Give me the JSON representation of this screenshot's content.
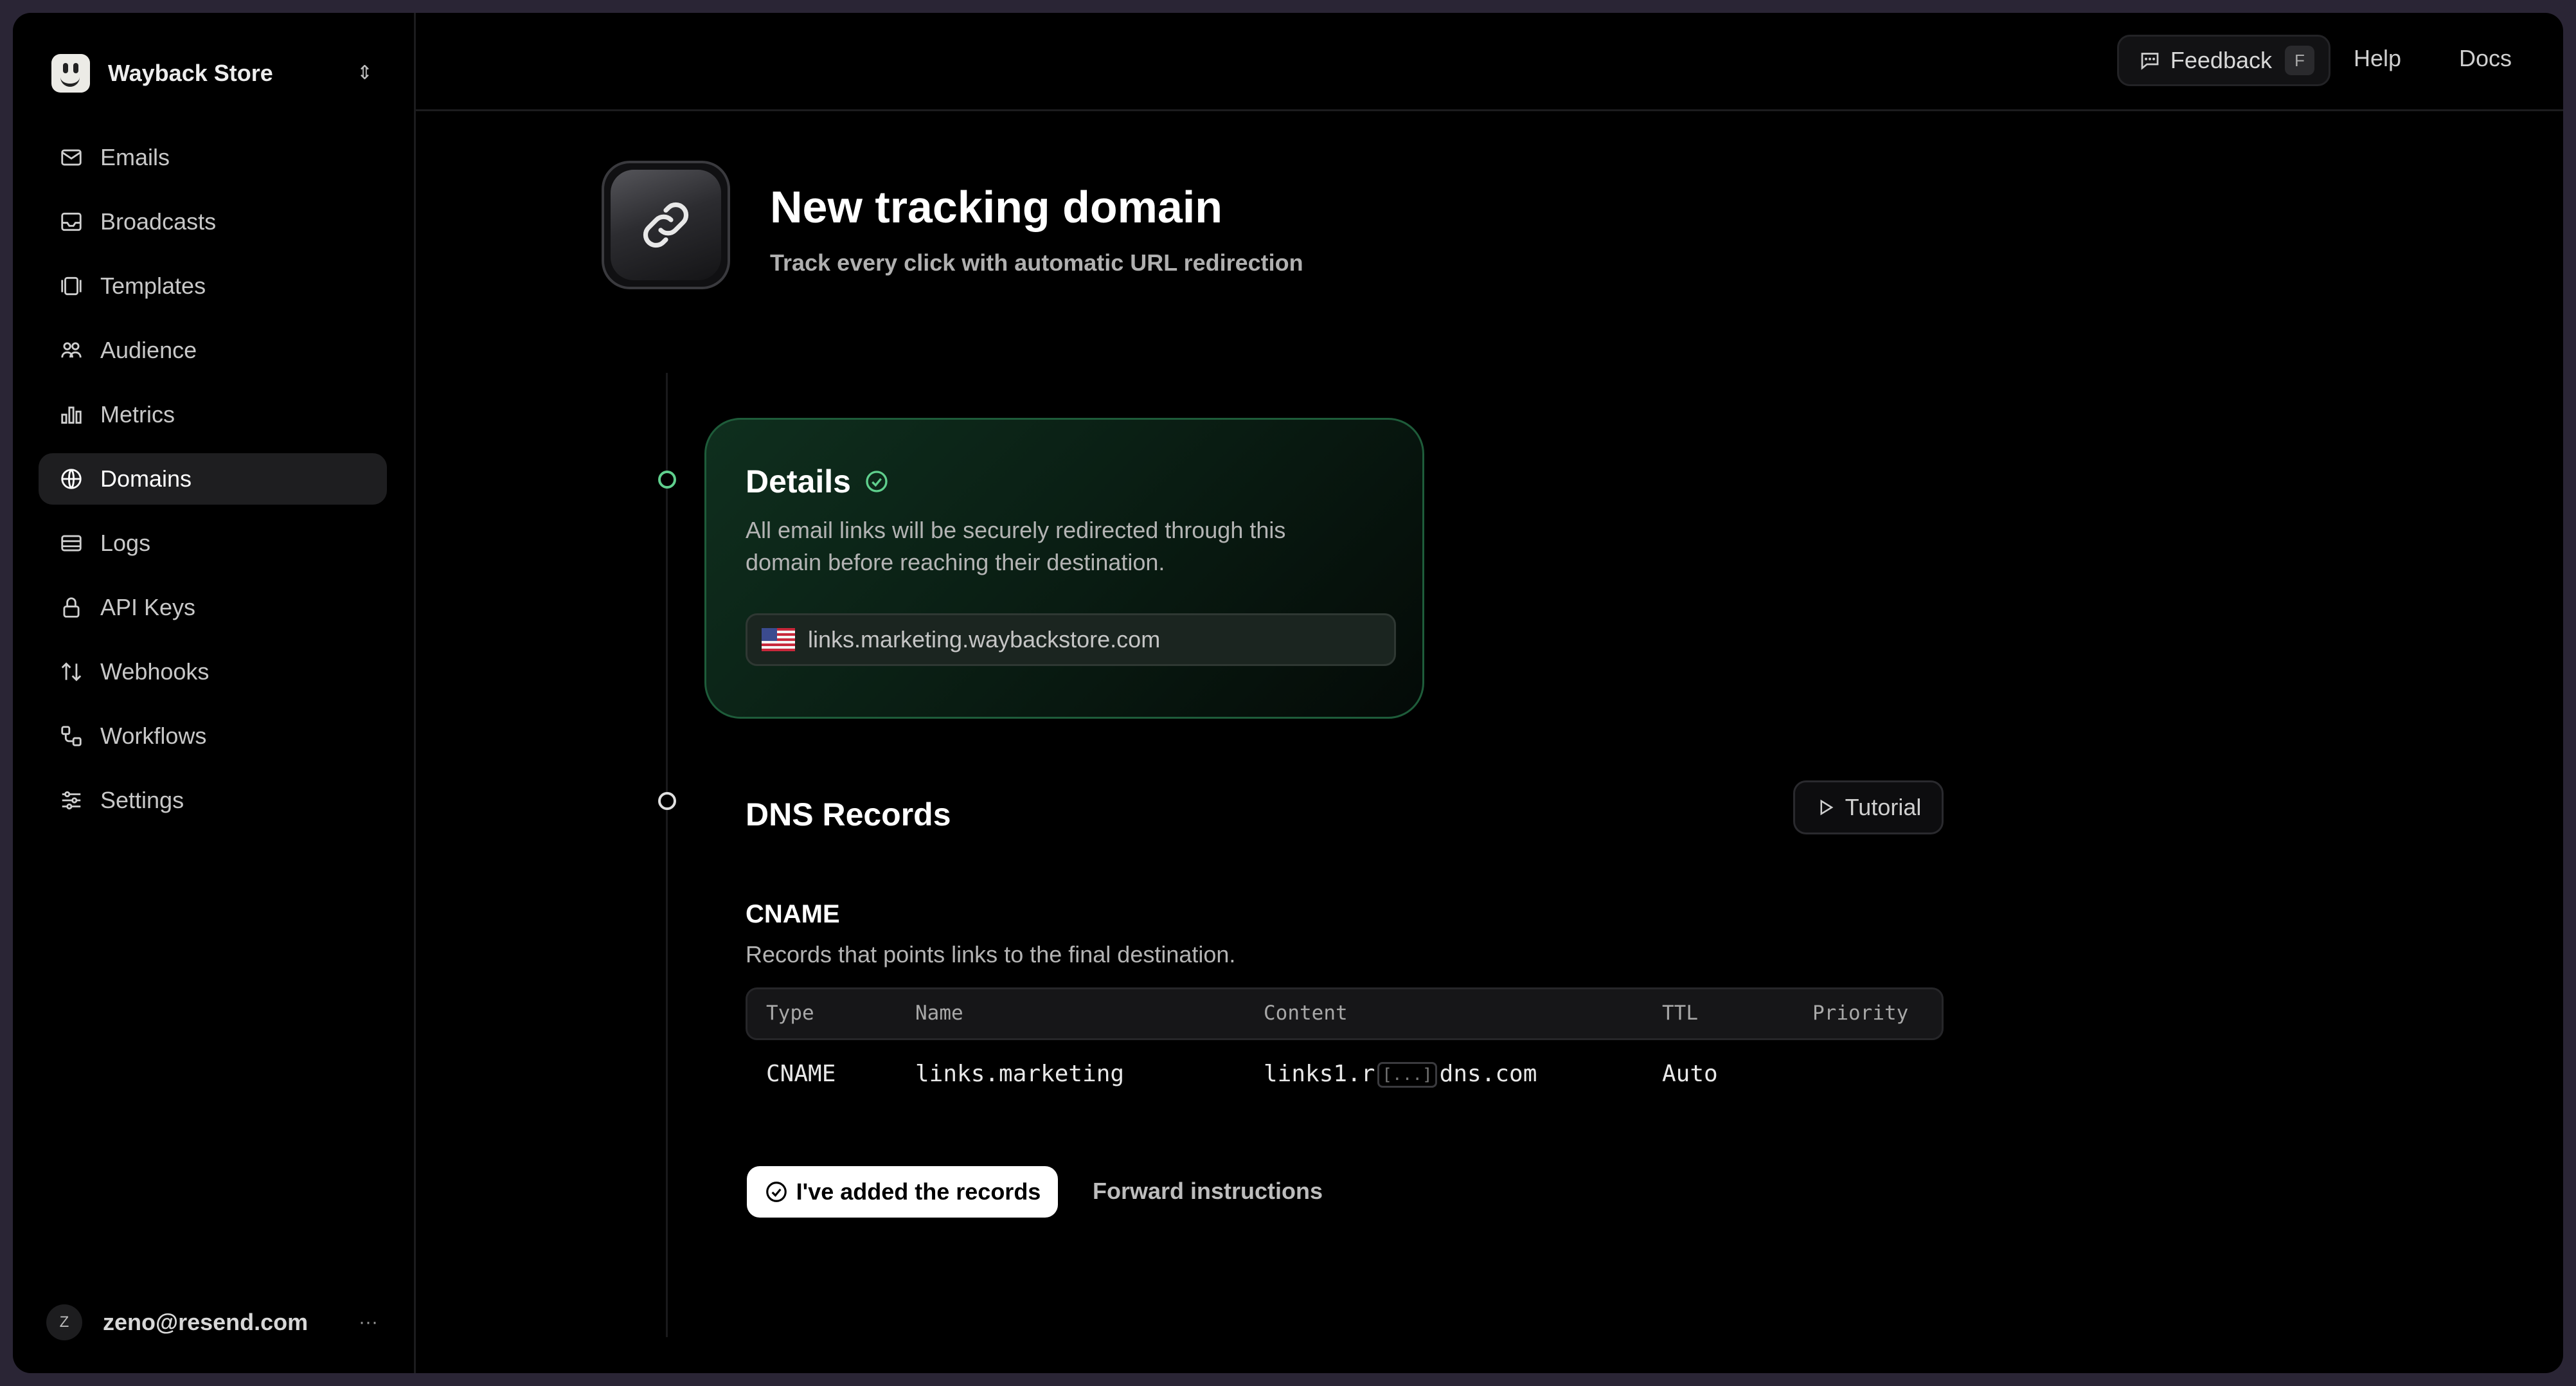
{
  "workspace": {
    "name": "Wayback Store"
  },
  "sidebar": {
    "items": [
      {
        "label": "Emails",
        "icon": "mail-icon"
      },
      {
        "label": "Broadcasts",
        "icon": "inbox-icon"
      },
      {
        "label": "Templates",
        "icon": "template-icon"
      },
      {
        "label": "Audience",
        "icon": "users-icon"
      },
      {
        "label": "Metrics",
        "icon": "bar-chart-icon"
      },
      {
        "label": "Domains",
        "icon": "globe-icon",
        "active": true
      },
      {
        "label": "Logs",
        "icon": "logs-icon"
      },
      {
        "label": "API Keys",
        "icon": "lock-icon"
      },
      {
        "label": "Webhooks",
        "icon": "arrows-icon"
      },
      {
        "label": "Workflows",
        "icon": "workflow-icon"
      },
      {
        "label": "Settings",
        "icon": "sliders-icon"
      }
    ]
  },
  "user": {
    "initial": "Z",
    "email": "zeno@resend.com",
    "more": "···"
  },
  "topbar": {
    "feedback_label": "Feedback",
    "feedback_key": "F",
    "help": "Help",
    "docs": "Docs"
  },
  "header": {
    "title": "New tracking domain",
    "subtitle": "Track every click with automatic URL redirection"
  },
  "details": {
    "title": "Details",
    "description": "All email links will be securely redirected through this domain before reaching their destination.",
    "domain_value": "links.marketing.waybackstore.com"
  },
  "dns": {
    "title": "DNS Records",
    "tutorial_label": "Tutorial",
    "section_title": "CNAME",
    "section_desc": "Records that points links to the final destination.",
    "columns": [
      "Type",
      "Name",
      "Content",
      "TTL",
      "Priority"
    ],
    "rows": [
      {
        "type": "CNAME",
        "name": "links.marketing",
        "content_start": "links1.r",
        "content_ellipsis": "[...]",
        "content_end": "dns.com",
        "ttl": "Auto",
        "priority": ""
      }
    ]
  },
  "actions": {
    "confirm_label": "I've added the records",
    "forward_label": "Forward instructions"
  },
  "colors": {
    "accent_green": "#5fcf8d",
    "card_border": "#1e5c3a",
    "background": "#000000"
  }
}
